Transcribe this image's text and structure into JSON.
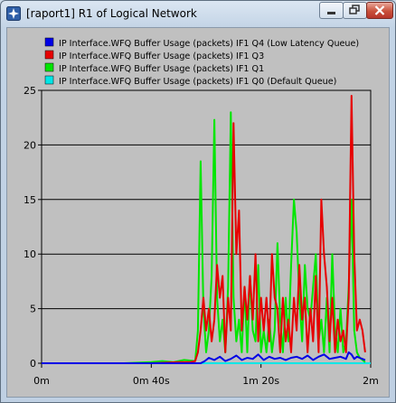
{
  "window": {
    "title": "[raport1] R1 of Logical Network",
    "controls": [
      "minimize",
      "maximize",
      "close"
    ]
  },
  "chart_data": {
    "type": "line",
    "title": "",
    "xlabel": "",
    "ylabel": "",
    "xlim": [
      0,
      120
    ],
    "ylim": [
      0,
      25
    ],
    "grid": "horizontal",
    "legend_placement": "top",
    "x_ticks": [
      {
        "value": 0,
        "label": "0m"
      },
      {
        "value": 40,
        "label": "0m 40s"
      },
      {
        "value": 80,
        "label": "1m 20s"
      },
      {
        "value": 120,
        "label": "2m"
      }
    ],
    "y_ticks": [
      0,
      5,
      10,
      15,
      20,
      25
    ],
    "background_color": "#c0c0c0",
    "series": [
      {
        "name": "IP Interface.WFQ Buffer Usage (packets) IF1 Q4 (Low Latency Queue)",
        "color": "#0000e6",
        "x": [
          0,
          20,
          40,
          50,
          54,
          56,
          58,
          59.5,
          61,
          63,
          65,
          67,
          69,
          71,
          73,
          75,
          77,
          79,
          81,
          83,
          85,
          87,
          89,
          91,
          93,
          95,
          97,
          99,
          101,
          103,
          105,
          107,
          109,
          111,
          112,
          113,
          114,
          115,
          116,
          118
        ],
        "y": [
          0,
          0,
          0,
          0,
          0,
          0,
          0,
          0.2,
          0.5,
          0.3,
          0.6,
          0.2,
          0.4,
          0.7,
          0.3,
          0.5,
          0.4,
          0.8,
          0.3,
          0.6,
          0.4,
          0.5,
          0.3,
          0.5,
          0.6,
          0.4,
          0.7,
          0.3,
          0.6,
          0.8,
          0.4,
          0.5,
          0.6,
          0.4,
          1.0,
          0.8,
          0.4,
          0.6,
          0.5,
          0.3
        ]
      },
      {
        "name": "IP Interface.WFQ Buffer Usage (packets) IF1 Q3",
        "color": "#e60000",
        "x": [
          0,
          20,
          40,
          50,
          54,
          56,
          57,
          58,
          59,
          60,
          61,
          62,
          63,
          64,
          65,
          66,
          67,
          68,
          69,
          70,
          71,
          72,
          73,
          74,
          75,
          76,
          77,
          78,
          79,
          80,
          81,
          82,
          83,
          84,
          85,
          86,
          87,
          88,
          89,
          90,
          91,
          92,
          93,
          94,
          95,
          96,
          97,
          98,
          99,
          100,
          101,
          102,
          103,
          104,
          105,
          106,
          107,
          108,
          109,
          110,
          111,
          112,
          113,
          114,
          115,
          116,
          117,
          118
        ],
        "y": [
          0,
          0,
          0,
          0.1,
          0.1,
          0.2,
          1,
          3,
          6,
          3,
          5,
          2,
          4,
          9,
          6,
          8,
          1,
          6,
          3,
          22,
          10,
          14,
          3,
          7,
          4,
          8,
          4,
          10,
          2,
          6,
          3,
          6,
          2,
          10,
          6,
          5,
          1,
          6,
          2,
          4,
          1,
          6,
          3,
          9,
          4,
          6,
          1,
          5,
          2,
          8,
          1,
          15,
          10,
          7,
          2,
          6,
          1,
          4,
          2,
          3,
          1,
          6,
          24.5,
          10,
          3,
          4,
          3,
          1
        ]
      },
      {
        "name": "IP Interface.WFQ Buffer Usage (packets) IF1 Q1",
        "color": "#00e600",
        "x": [
          0,
          20,
          30,
          40,
          44,
          48,
          52,
          56,
          57,
          58,
          59,
          60,
          61,
          62,
          63,
          64,
          65,
          66,
          67,
          68,
          69,
          70,
          71,
          72,
          73,
          74,
          75,
          76,
          77,
          78,
          79,
          80,
          81,
          82,
          83,
          84,
          85,
          86,
          87,
          88,
          89,
          90,
          91,
          92,
          93,
          94,
          95,
          96,
          97,
          98,
          99,
          100,
          101,
          102,
          103,
          104,
          105,
          106,
          107,
          108,
          109,
          110,
          111,
          112,
          113,
          114,
          115,
          116,
          117,
          118
        ],
        "y": [
          0,
          0,
          0,
          0.1,
          0.2,
          0.1,
          0.3,
          0.2,
          3,
          18.5,
          5,
          1,
          3,
          8,
          22.3,
          6,
          2,
          4,
          1,
          7,
          23,
          6,
          2,
          4,
          1,
          7,
          1,
          8,
          3,
          2,
          9,
          1,
          3,
          1,
          4,
          1,
          3,
          11,
          4,
          1,
          6,
          2,
          9,
          15,
          12,
          6,
          2,
          9,
          5,
          4,
          7,
          10,
          2,
          4,
          1,
          6,
          1,
          10,
          3,
          1,
          5,
          1,
          2,
          7,
          15,
          3,
          1,
          0.5,
          0.3,
          0.1
        ]
      },
      {
        "name": "IP Interface.WFQ Buffer Usage (packets) IF1 Q0 (Default Queue)",
        "color": "#00e6e6",
        "x": [
          0,
          60,
          120
        ],
        "y": [
          0,
          0,
          0
        ]
      }
    ]
  }
}
